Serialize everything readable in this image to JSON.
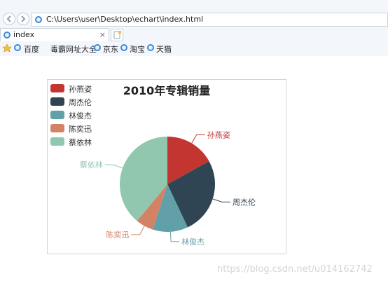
{
  "browser": {
    "address": "C:\\Users\\user\\Desktop\\echart\\index.html",
    "tab_label": "index",
    "tab_close": "×",
    "favorites": [
      "百度",
      "毒霸网址大全",
      "京东",
      "淘宝",
      "天猫"
    ]
  },
  "chart_data": {
    "type": "pie",
    "title": "2010年专辑销量",
    "categories": [
      "孙燕姿",
      "周杰伦",
      "林俊杰",
      "陈奕迅",
      "蔡依林"
    ],
    "values": [
      17,
      26,
      12,
      6,
      39
    ],
    "colors": [
      "#c23531",
      "#2f4554",
      "#61a0a8",
      "#d48265",
      "#91c7ae"
    ],
    "legend_position": "top-left"
  },
  "watermark": "https://blog.csdn.net/u014162742"
}
